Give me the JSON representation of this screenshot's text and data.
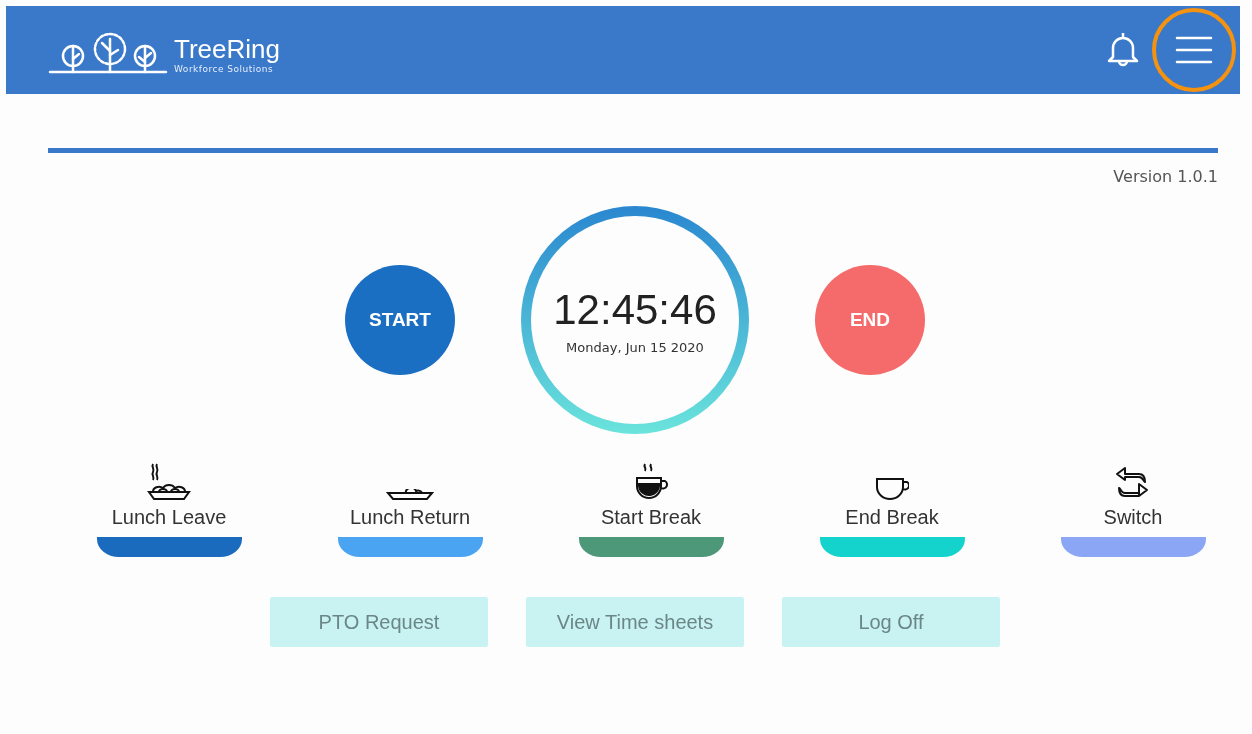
{
  "header": {
    "brand": "TreeRing",
    "tagline": "Workforce Solutions",
    "menu_highlighted": true
  },
  "version": "Version 1.0.1",
  "clock": {
    "time": "12:45:46",
    "date": "Monday, Jun 15 2020"
  },
  "punch_buttons": [
    {
      "label": "START",
      "color": "#1b6fc2"
    },
    {
      "label": "END",
      "color": "#f56b6b"
    }
  ],
  "actions": [
    {
      "kind": "noodles",
      "label": "Lunch Leave",
      "color": "#1a6bbd"
    },
    {
      "kind": "plate",
      "label": "Lunch Return",
      "color": "#4aa4f2"
    },
    {
      "kind": "coffee",
      "label": "Start Break",
      "color": "#4e987a"
    },
    {
      "kind": "cup",
      "label": "End Break",
      "color": "#14d2cc"
    },
    {
      "kind": "switch",
      "label": "Switch",
      "color": "#8aa6f4"
    }
  ],
  "links": [
    "PTO Request",
    "View Time sheets",
    "Log Off"
  ]
}
